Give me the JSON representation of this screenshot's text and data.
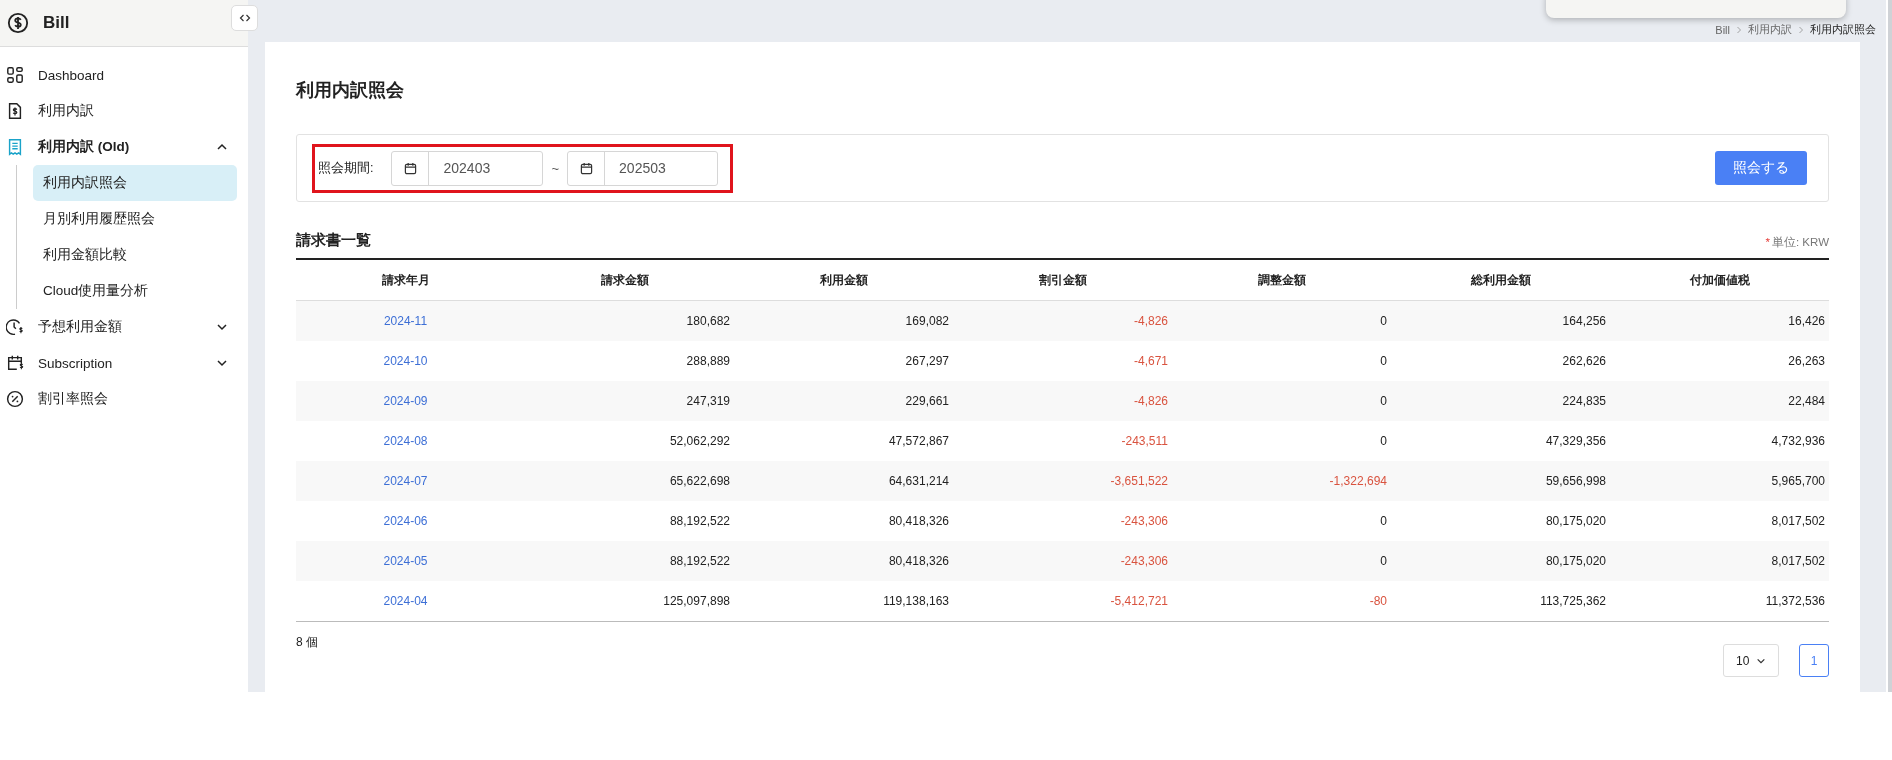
{
  "app": {
    "title": "Bill"
  },
  "sidebar": {
    "items": [
      {
        "label": "Dashboard"
      },
      {
        "label": "利用内訳"
      },
      {
        "label": "利用内訳 (Old)",
        "expanded": true,
        "children": [
          {
            "label": "利用内訳照会",
            "selected": true
          },
          {
            "label": "月別利用履歴照会",
            "selected": false
          },
          {
            "label": "利用金額比較",
            "selected": false
          },
          {
            "label": "Cloud使用量分析",
            "selected": false
          }
        ]
      },
      {
        "label": "予想利用金額",
        "expanded": false
      },
      {
        "label": "Subscription",
        "expanded": false
      },
      {
        "label": "割引率照会"
      }
    ]
  },
  "breadcrumb": [
    "Bill",
    "利用内訳",
    "利用内訳照会"
  ],
  "page_title": "利用内訳照会",
  "filter": {
    "label": "照会期間:",
    "from": "202403",
    "separator": "~",
    "to": "202503",
    "highlighted": true,
    "button": "照会する"
  },
  "section_title": "請求書一覧",
  "unit_note": {
    "mark": "*",
    "text": "単位: KRW"
  },
  "table": {
    "columns": [
      "請求年月",
      "請求金額",
      "利用金額",
      "割引金額",
      "調整金額",
      "総利用金額",
      "付加価値税"
    ],
    "rows": [
      {
        "cells": [
          {
            "value": "2024-11",
            "negative": false
          },
          {
            "value": "180,682",
            "negative": false
          },
          {
            "value": "169,082",
            "negative": false
          },
          {
            "value": "-4,826",
            "negative": true
          },
          {
            "value": "0",
            "negative": false
          },
          {
            "value": "164,256",
            "negative": false
          },
          {
            "value": "16,426",
            "negative": false
          }
        ]
      },
      {
        "cells": [
          {
            "value": "2024-10",
            "negative": false
          },
          {
            "value": "288,889",
            "negative": false
          },
          {
            "value": "267,297",
            "negative": false
          },
          {
            "value": "-4,671",
            "negative": true
          },
          {
            "value": "0",
            "negative": false
          },
          {
            "value": "262,626",
            "negative": false
          },
          {
            "value": "26,263",
            "negative": false
          }
        ]
      },
      {
        "cells": [
          {
            "value": "2024-09",
            "negative": false
          },
          {
            "value": "247,319",
            "negative": false
          },
          {
            "value": "229,661",
            "negative": false
          },
          {
            "value": "-4,826",
            "negative": true
          },
          {
            "value": "0",
            "negative": false
          },
          {
            "value": "224,835",
            "negative": false
          },
          {
            "value": "22,484",
            "negative": false
          }
        ]
      },
      {
        "cells": [
          {
            "value": "2024-08",
            "negative": false
          },
          {
            "value": "52,062,292",
            "negative": false
          },
          {
            "value": "47,572,867",
            "negative": false
          },
          {
            "value": "-243,511",
            "negative": true
          },
          {
            "value": "0",
            "negative": false
          },
          {
            "value": "47,329,356",
            "negative": false
          },
          {
            "value": "4,732,936",
            "negative": false
          }
        ]
      },
      {
        "cells": [
          {
            "value": "2024-07",
            "negative": false
          },
          {
            "value": "65,622,698",
            "negative": false
          },
          {
            "value": "64,631,214",
            "negative": false
          },
          {
            "value": "-3,651,522",
            "negative": true
          },
          {
            "value": "-1,322,694",
            "negative": true
          },
          {
            "value": "59,656,998",
            "negative": false
          },
          {
            "value": "5,965,700",
            "negative": false
          }
        ]
      },
      {
        "cells": [
          {
            "value": "2024-06",
            "negative": false
          },
          {
            "value": "88,192,522",
            "negative": false
          },
          {
            "value": "80,418,326",
            "negative": false
          },
          {
            "value": "-243,306",
            "negative": true
          },
          {
            "value": "0",
            "negative": false
          },
          {
            "value": "80,175,020",
            "negative": false
          },
          {
            "value": "8,017,502",
            "negative": false
          }
        ]
      },
      {
        "cells": [
          {
            "value": "2024-05",
            "negative": false
          },
          {
            "value": "88,192,522",
            "negative": false
          },
          {
            "value": "80,418,326",
            "negative": false
          },
          {
            "value": "-243,306",
            "negative": true
          },
          {
            "value": "0",
            "negative": false
          },
          {
            "value": "80,175,020",
            "negative": false
          },
          {
            "value": "8,017,502",
            "negative": false
          }
        ]
      },
      {
        "cells": [
          {
            "value": "2024-04",
            "negative": false
          },
          {
            "value": "125,097,898",
            "negative": false
          },
          {
            "value": "119,138,163",
            "negative": false
          },
          {
            "value": "-5,412,721",
            "negative": true
          },
          {
            "value": "-80",
            "negative": true
          },
          {
            "value": "113,725,362",
            "negative": false
          },
          {
            "value": "11,372,536",
            "negative": false
          }
        ]
      }
    ]
  },
  "footer": {
    "count": "8 個",
    "page_size": "10",
    "pages": [
      {
        "label": "1",
        "selected": true
      }
    ]
  }
}
